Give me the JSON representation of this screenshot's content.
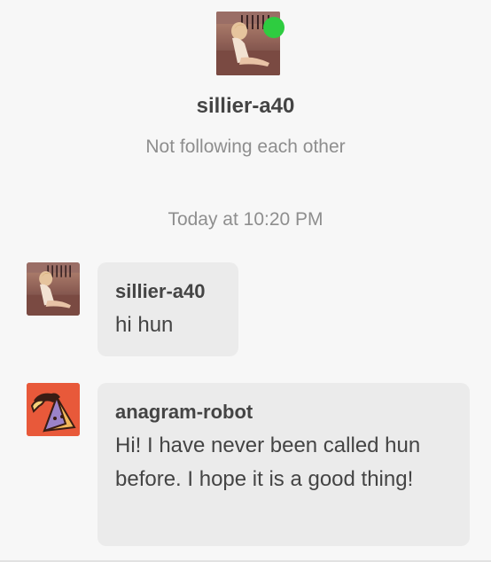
{
  "profile": {
    "username": "sillier-a40",
    "follow_status": "Not following each other",
    "online": true,
    "online_color": "#2ecc40"
  },
  "conversation": {
    "timestamp": "Today at 10:20 PM",
    "messages": [
      {
        "sender": "sillier-a40",
        "text": "hi hun",
        "avatar_icon": "user-photo-avatar"
      },
      {
        "sender": "anagram-robot",
        "text": "Hi! I have never been called hun before. I hope it is a good thing!",
        "avatar_icon": "robot-avatar"
      }
    ]
  }
}
